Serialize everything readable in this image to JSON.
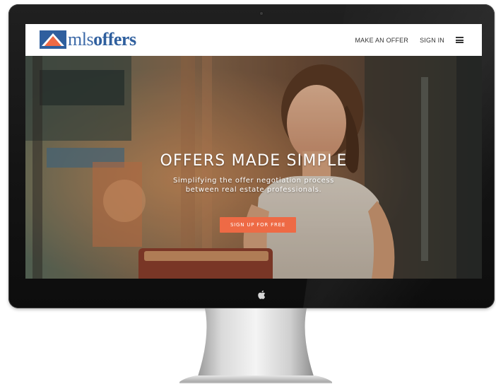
{
  "brand": {
    "name_light": "mls",
    "name_bold": "offers",
    "logo_icon": "house-roof-logo-icon",
    "primary_color": "#2f5f9e",
    "accent_color": "#ee6a45"
  },
  "nav": {
    "items": [
      {
        "label": "MAKE AN OFFER"
      },
      {
        "label": "SIGN IN"
      }
    ],
    "menu_icon": "hamburger-menu-icon"
  },
  "hero": {
    "title": "OFFERS MADE SIMPLE",
    "subtitle_line1": "Simplifying the offer negotiation process",
    "subtitle_line2": "between real estate professionals.",
    "cta_label": "SIGN UP FOR FREE"
  },
  "device": {
    "logo_icon": "apple-logo-icon"
  }
}
